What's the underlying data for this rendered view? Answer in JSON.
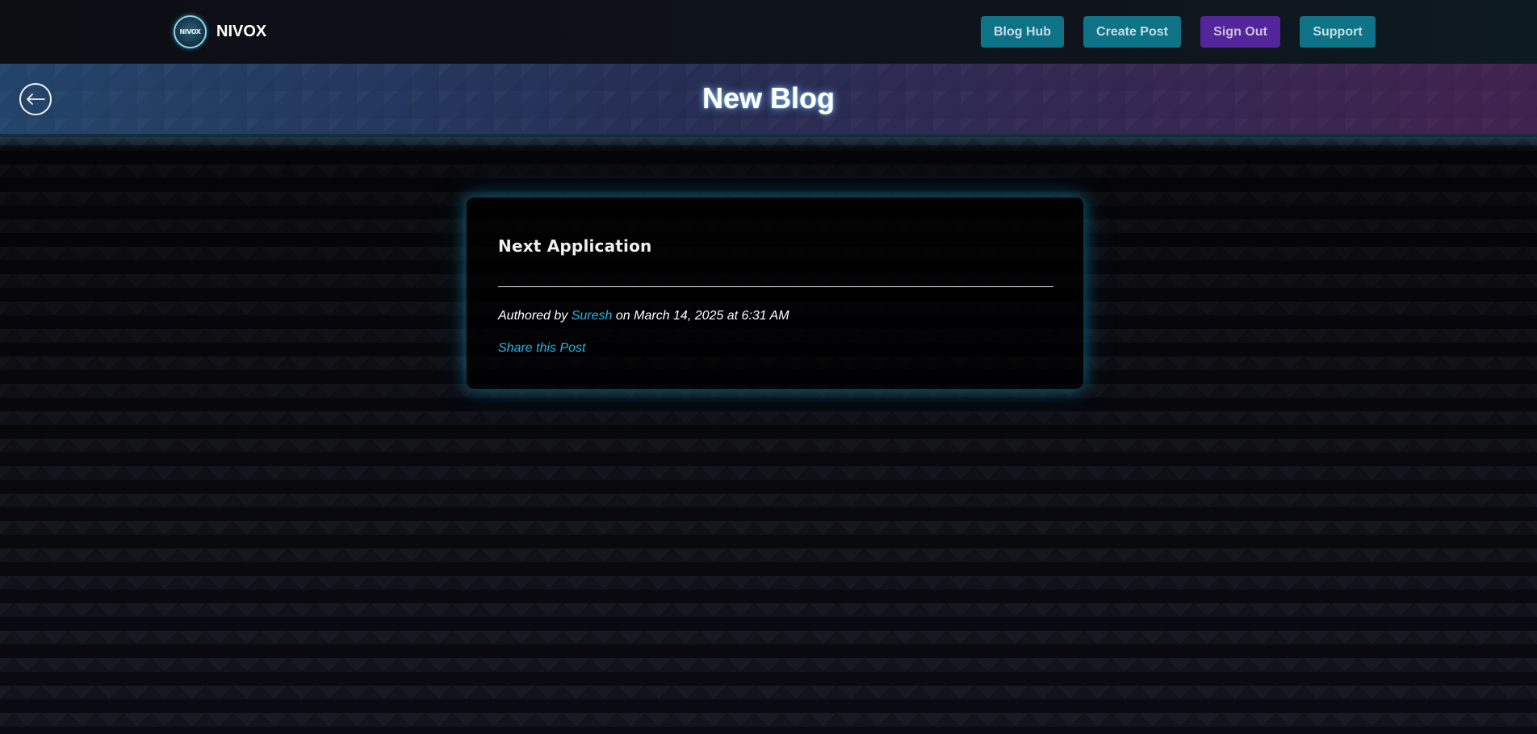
{
  "brand": {
    "name": "NIVOX",
    "logo_text": "NIVOX"
  },
  "nav": {
    "blog_hub": "Blog Hub",
    "create_post": "Create Post",
    "sign_out": "Sign Out",
    "support": "Support"
  },
  "banner": {
    "title": "New Blog",
    "back_icon": "arrow-left-icon"
  },
  "post": {
    "title": "Next Application",
    "authored_by": "Authored by",
    "author": "Suresh",
    "date_text": "on March 14, 2025 at 6:31 AM",
    "share_label": "Share this Post"
  },
  "colors": {
    "accent_teal": "#0e7386",
    "accent_purple": "#52259a",
    "link": "#1fb7e6",
    "background": "#0b0b12"
  }
}
